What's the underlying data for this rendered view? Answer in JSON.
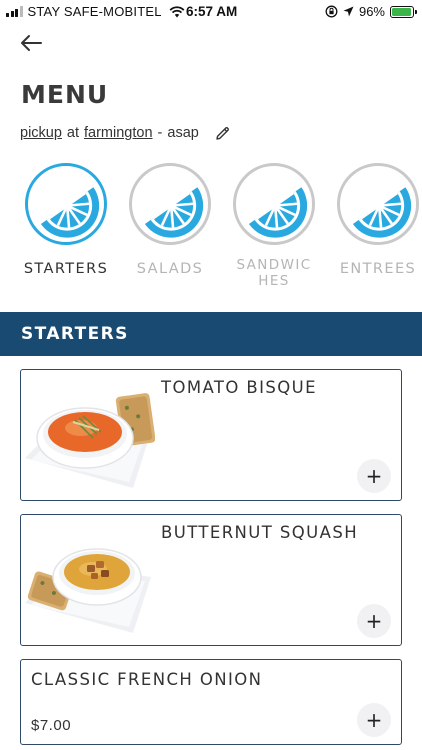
{
  "status_bar": {
    "carrier": "STAY SAFE-MOBITEL",
    "time": "6:57 AM",
    "battery": "96%",
    "battery_level": 0.96,
    "icons": [
      "signal-icon",
      "wifi-icon",
      "rotation-lock-icon",
      "location-arrow-icon",
      "battery-icon"
    ]
  },
  "header": {
    "back_icon": "arrow-left-icon",
    "title": "MENU"
  },
  "order": {
    "method": "pickup",
    "at": "at",
    "location": "farmington",
    "dash": "-",
    "time": "asap",
    "edit_icon": "pencil-icon"
  },
  "categories": [
    {
      "label": "STARTERS",
      "active": true,
      "icon": "citrus-slice-icon"
    },
    {
      "label": "SALADS",
      "active": false,
      "icon": "citrus-slice-icon"
    },
    {
      "label": "SANDWIC HES",
      "active": false,
      "icon": "citrus-slice-icon"
    },
    {
      "label": "ENTREES",
      "active": false,
      "icon": "citrus-slice-icon"
    }
  ],
  "section": {
    "title": "STARTERS"
  },
  "items": [
    {
      "name": "TOMATO BISQUE",
      "price": "",
      "image": "tomato-bisque-photo",
      "add_label": "+"
    },
    {
      "name": "BUTTERNUT SQUASH",
      "price": "",
      "image": "butternut-squash-photo",
      "add_label": "+"
    },
    {
      "name": "CLASSIC FRENCH ONION",
      "price": "$7.00",
      "image": "",
      "add_label": "+"
    }
  ],
  "colors": {
    "accent": "#29a9df",
    "section_bar": "#184a72",
    "card_border": "#2e4a68",
    "inactive_ring": "#c9c9c9"
  }
}
